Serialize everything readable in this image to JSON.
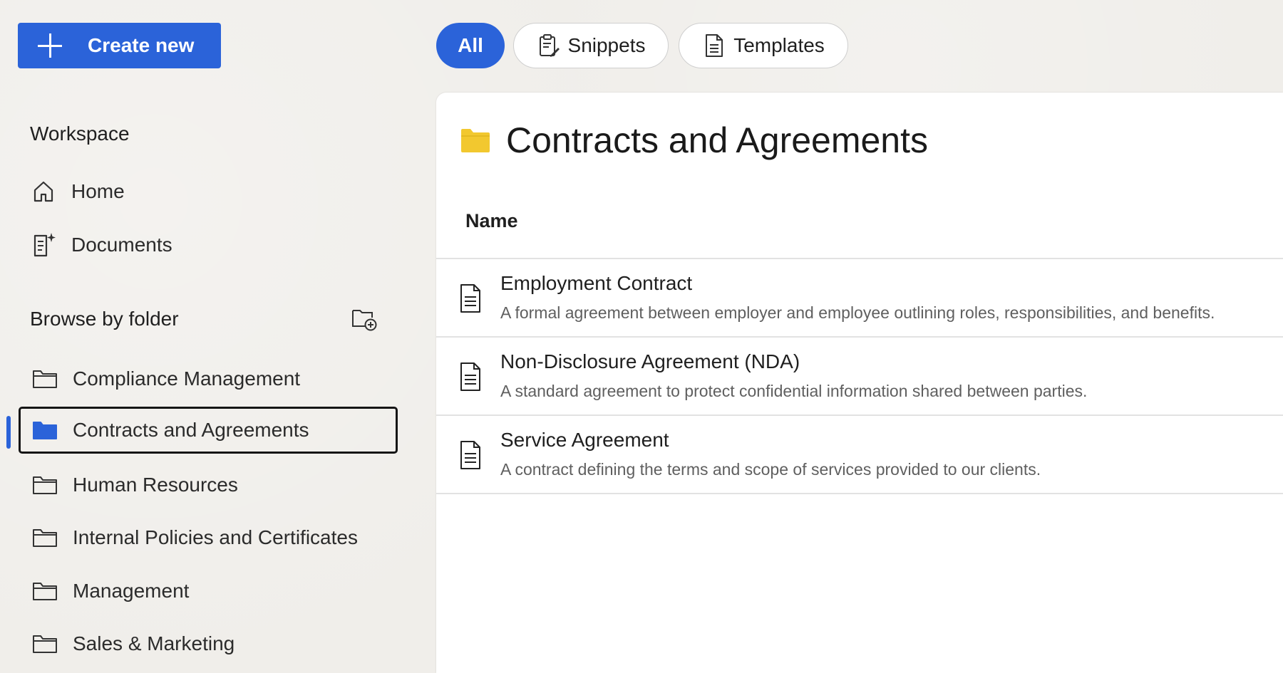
{
  "sidebar": {
    "create_button": "Create new",
    "workspace_title": "Workspace",
    "workspace_items": [
      {
        "label": "Home",
        "icon": "home-icon"
      },
      {
        "label": "Documents",
        "icon": "documents-sparkle-icon"
      }
    ],
    "folders_title": "Browse by folder",
    "folders": [
      {
        "label": "Compliance Management",
        "selected": false
      },
      {
        "label": "Contracts and Agreements",
        "selected": true
      },
      {
        "label": "Human Resources",
        "selected": false
      },
      {
        "label": "Internal Policies and Certificates",
        "selected": false
      },
      {
        "label": "Management",
        "selected": false
      },
      {
        "label": "Sales & Marketing",
        "selected": false
      }
    ]
  },
  "filters": {
    "all": "All",
    "snippets": "Snippets",
    "templates": "Templates",
    "active": "All"
  },
  "main": {
    "title": "Contracts and Agreements",
    "column_name": "Name",
    "rows": [
      {
        "title": "Employment Contract",
        "description": "A formal agreement between employer and employee outlining roles, responsibilities, and benefits."
      },
      {
        "title": "Non-Disclosure Agreement (NDA)",
        "description": "A standard agreement to protect confidential information shared between parties."
      },
      {
        "title": "Service Agreement",
        "description": "A contract defining the terms and scope of services provided to our clients."
      }
    ]
  },
  "colors": {
    "accent": "#2b63d9",
    "folder_yellow": "#f2c82f",
    "panel_background": "#ffffff",
    "page_background": "#f0eeea"
  }
}
